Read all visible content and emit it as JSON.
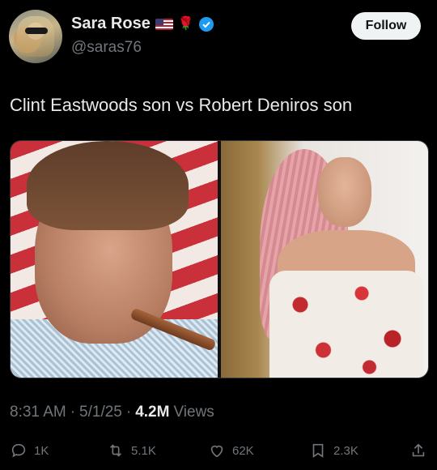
{
  "author": {
    "name": "Sara Rose",
    "handle": "@saras76",
    "follow_label": "Follow"
  },
  "post": {
    "text": "Clint Eastwoods son vs Robert Deniros son",
    "time": "8:31 AM",
    "date": "5/1/25",
    "views_count": "4.2M",
    "views_label": "Views"
  },
  "actions": {
    "replies": "1K",
    "reposts": "5.1K",
    "likes": "62K",
    "bookmarks": "2.3K"
  },
  "colors": {
    "background": "#000000",
    "text": "#e7e9ea",
    "muted": "#71767b",
    "verified": "#1d9bf0"
  }
}
